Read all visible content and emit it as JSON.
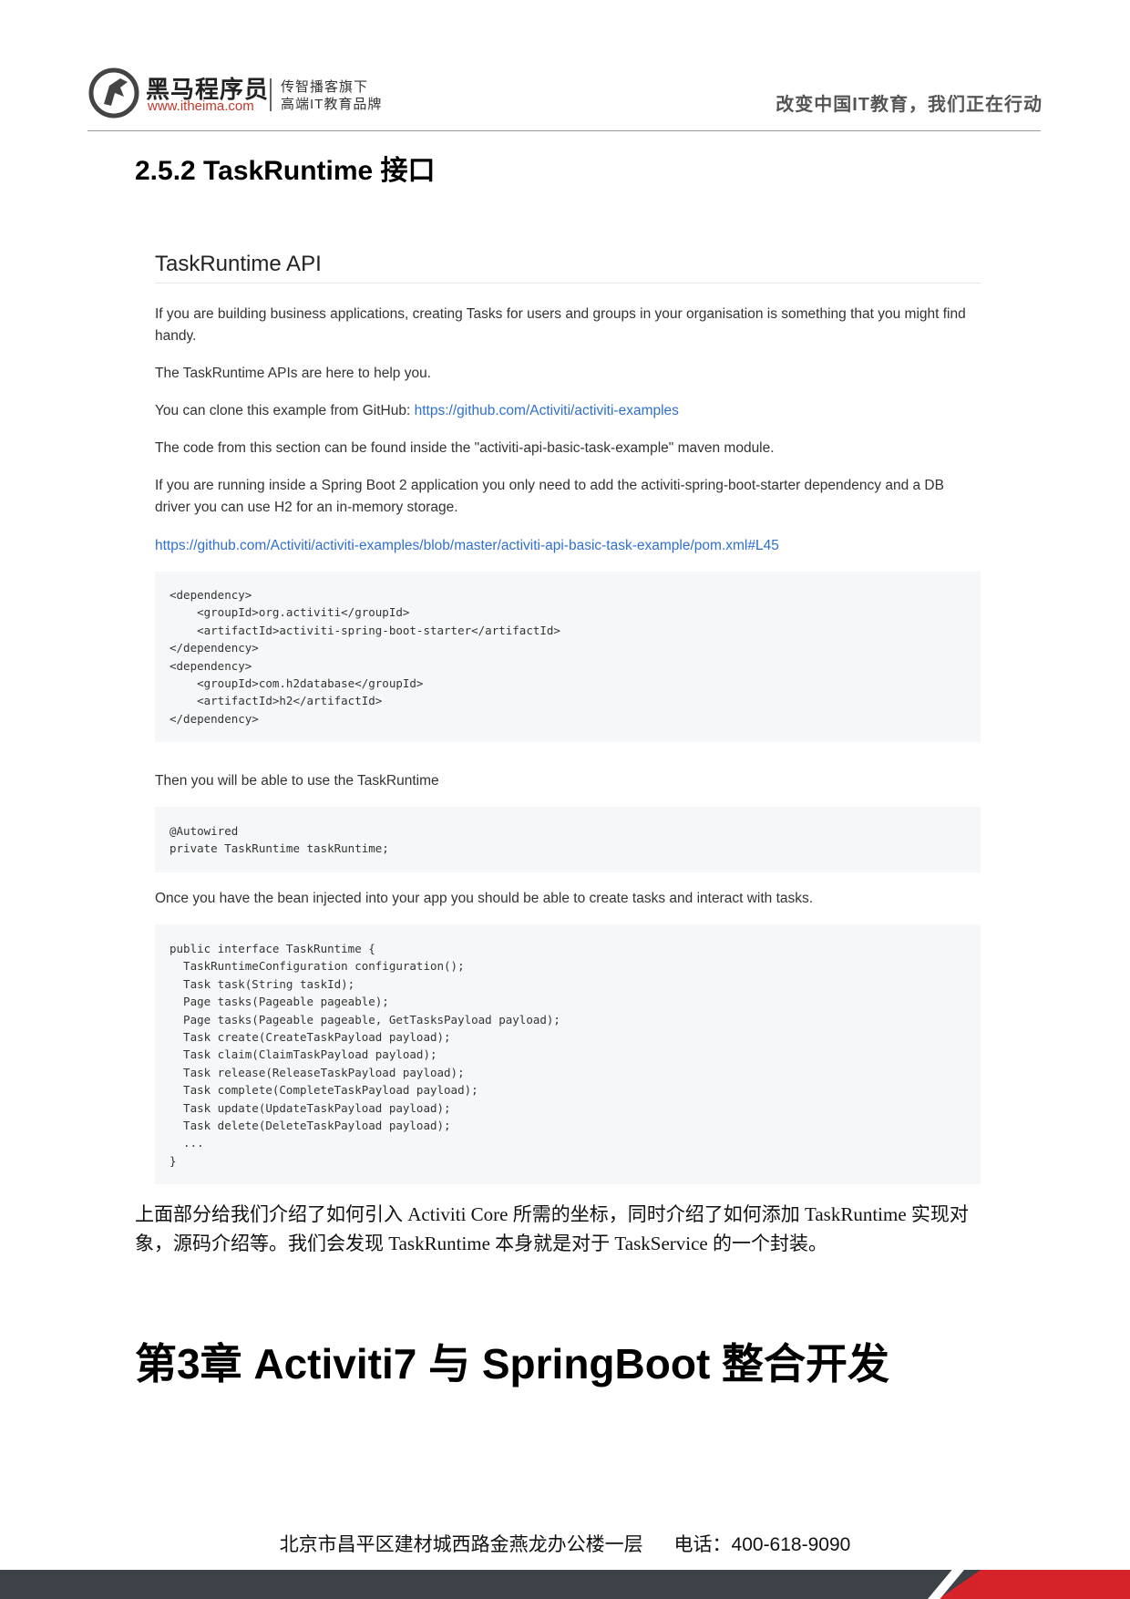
{
  "header": {
    "brand_cn": "黑马程序员",
    "brand_url": "www.itheima.com",
    "tagline_1": "传智播客旗下",
    "tagline_2": "高端IT教育品牌",
    "slogan": "改变中国IT教育，我们正在行动"
  },
  "section_heading": "2.5.2 TaskRuntime 接口",
  "doc": {
    "title": "TaskRuntime API",
    "p1": "If you are building business applications, creating Tasks for users and groups in your organisation is something that you might find handy.",
    "p2": "The TaskRuntime APIs are here to help you.",
    "p3_prefix": "You can clone this example from GitHub: ",
    "p3_link": "https://github.com/Activiti/activiti-examples",
    "p4": "The code from this section can be found inside the \"activiti-api-basic-task-example\" maven module.",
    "p5": "If you are running inside a Spring Boot 2 application you only need to add the activiti-spring-boot-starter dependency and a DB driver you can use H2 for an in-memory storage.",
    "p6_link": "https://github.com/Activiti/activiti-examples/blob/master/activiti-api-basic-task-example/pom.xml#L45",
    "code1": "<dependency>\n    <groupId>org.activiti</groupId>\n    <artifactId>activiti-spring-boot-starter</artifactId>\n</dependency>\n<dependency>\n    <groupId>com.h2database</groupId>\n    <artifactId>h2</artifactId>\n</dependency>",
    "p7": "Then you will be able to use the TaskRuntime",
    "code2": "@Autowired\nprivate TaskRuntime taskRuntime;",
    "p8": "Once you have the bean injected into your app you should be able to create tasks and interact with tasks.",
    "code3": "public interface TaskRuntime {\n  TaskRuntimeConfiguration configuration();\n  Task task(String taskId);\n  Page tasks(Pageable pageable);\n  Page tasks(Pageable pageable, GetTasksPayload payload);\n  Task create(CreateTaskPayload payload);\n  Task claim(ClaimTaskPayload payload);\n  Task release(ReleaseTaskPayload payload);\n  Task complete(CompleteTaskPayload payload);\n  Task update(UpdateTaskPayload payload);\n  Task delete(DeleteTaskPayload payload);\n  ...\n}"
  },
  "cn_paragraph": "上面部分给我们介绍了如何引入 Activiti Core 所需的坐标，同时介绍了如何添加 TaskRuntime 实现对象，源码介绍等。我们会发现 TaskRuntime 本身就是对于 TaskService 的一个封装。",
  "chapter_title": "第3章 Activiti7 与 SpringBoot 整合开发",
  "footer": {
    "address": "北京市昌平区建材城西路金燕龙办公楼一层",
    "phone": "电话：400-618-9090"
  }
}
